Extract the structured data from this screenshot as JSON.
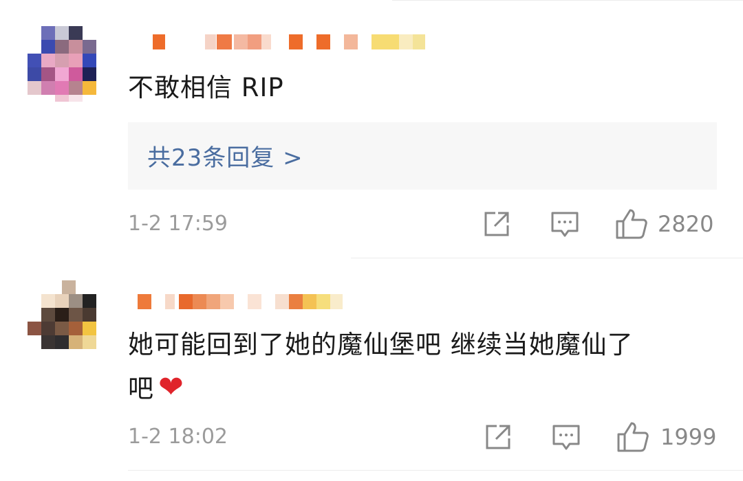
{
  "comments": [
    {
      "text": "不敢相信 RIP",
      "replies_label": "共23条回复 >",
      "time": "1-2 17:59",
      "likes": "2820"
    },
    {
      "text_line1": "她可能回到了她的魔仙堡吧 继续当她魔仙了",
      "text_line2": "吧",
      "emoji": "❤",
      "time": "1-2 18:02",
      "likes": "1999"
    }
  ],
  "icons": {
    "share": "share-icon",
    "comment": "comment-icon",
    "like": "thumbs-up-icon"
  },
  "colors": {
    "reply_link": "#4a6da0",
    "meta_gray": "#9b9b9b",
    "heart": "#e0242b"
  }
}
